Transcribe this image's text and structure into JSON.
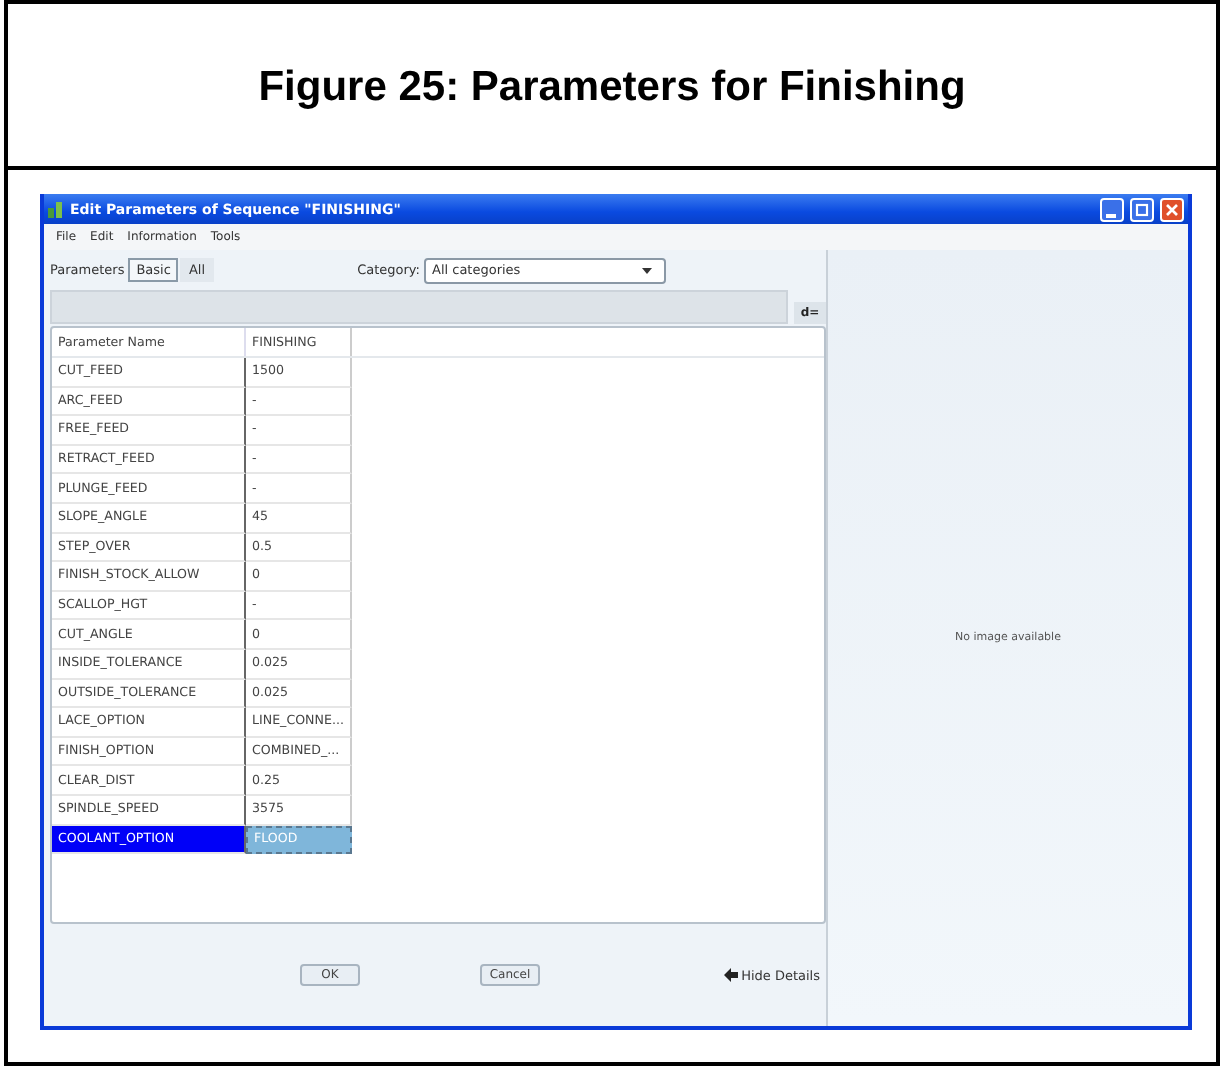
{
  "figure_title": "Figure 25: Parameters for Finishing",
  "window": {
    "title": "Edit Parameters of Sequence \"FINISHING\""
  },
  "menu": [
    "File",
    "Edit",
    "Information",
    "Tools"
  ],
  "parameters_label": "Parameters",
  "parameter_tabs": [
    {
      "label": "Basic",
      "selected": true
    },
    {
      "label": "All",
      "selected": false
    }
  ],
  "category": {
    "label": "Category:",
    "value": "All categories"
  },
  "toggle_button": "d=",
  "table": {
    "columns": [
      "Parameter Name",
      "FINISHING"
    ],
    "rows": [
      {
        "name": "CUT_FEED",
        "value": "1500",
        "selected": false
      },
      {
        "name": "ARC_FEED",
        "value": "-",
        "selected": false
      },
      {
        "name": "FREE_FEED",
        "value": "-",
        "selected": false
      },
      {
        "name": "RETRACT_FEED",
        "value": "-",
        "selected": false
      },
      {
        "name": "PLUNGE_FEED",
        "value": "-",
        "selected": false
      },
      {
        "name": "SLOPE_ANGLE",
        "value": "45",
        "selected": false
      },
      {
        "name": "STEP_OVER",
        "value": "0.5",
        "selected": false
      },
      {
        "name": "FINISH_STOCK_ALLOW",
        "value": "0",
        "selected": false
      },
      {
        "name": "SCALLOP_HGT",
        "value": "-",
        "selected": false
      },
      {
        "name": "CUT_ANGLE",
        "value": "0",
        "selected": false
      },
      {
        "name": "INSIDE_TOLERANCE",
        "value": "0.025",
        "selected": false
      },
      {
        "name": "OUTSIDE_TOLERANCE",
        "value": "0.025",
        "selected": false
      },
      {
        "name": "LACE_OPTION",
        "value": "LINE_CONNE...",
        "selected": false
      },
      {
        "name": "FINISH_OPTION",
        "value": "COMBINED_...",
        "selected": false
      },
      {
        "name": "CLEAR_DIST",
        "value": "0.25",
        "selected": false
      },
      {
        "name": "SPINDLE_SPEED",
        "value": "3575",
        "selected": false
      },
      {
        "name": "COOLANT_OPTION",
        "value": "FLOOD",
        "selected": true
      }
    ]
  },
  "buttons": [
    "OK",
    "Cancel"
  ],
  "hide_details": "Hide Details",
  "preview_text": "No image available"
}
